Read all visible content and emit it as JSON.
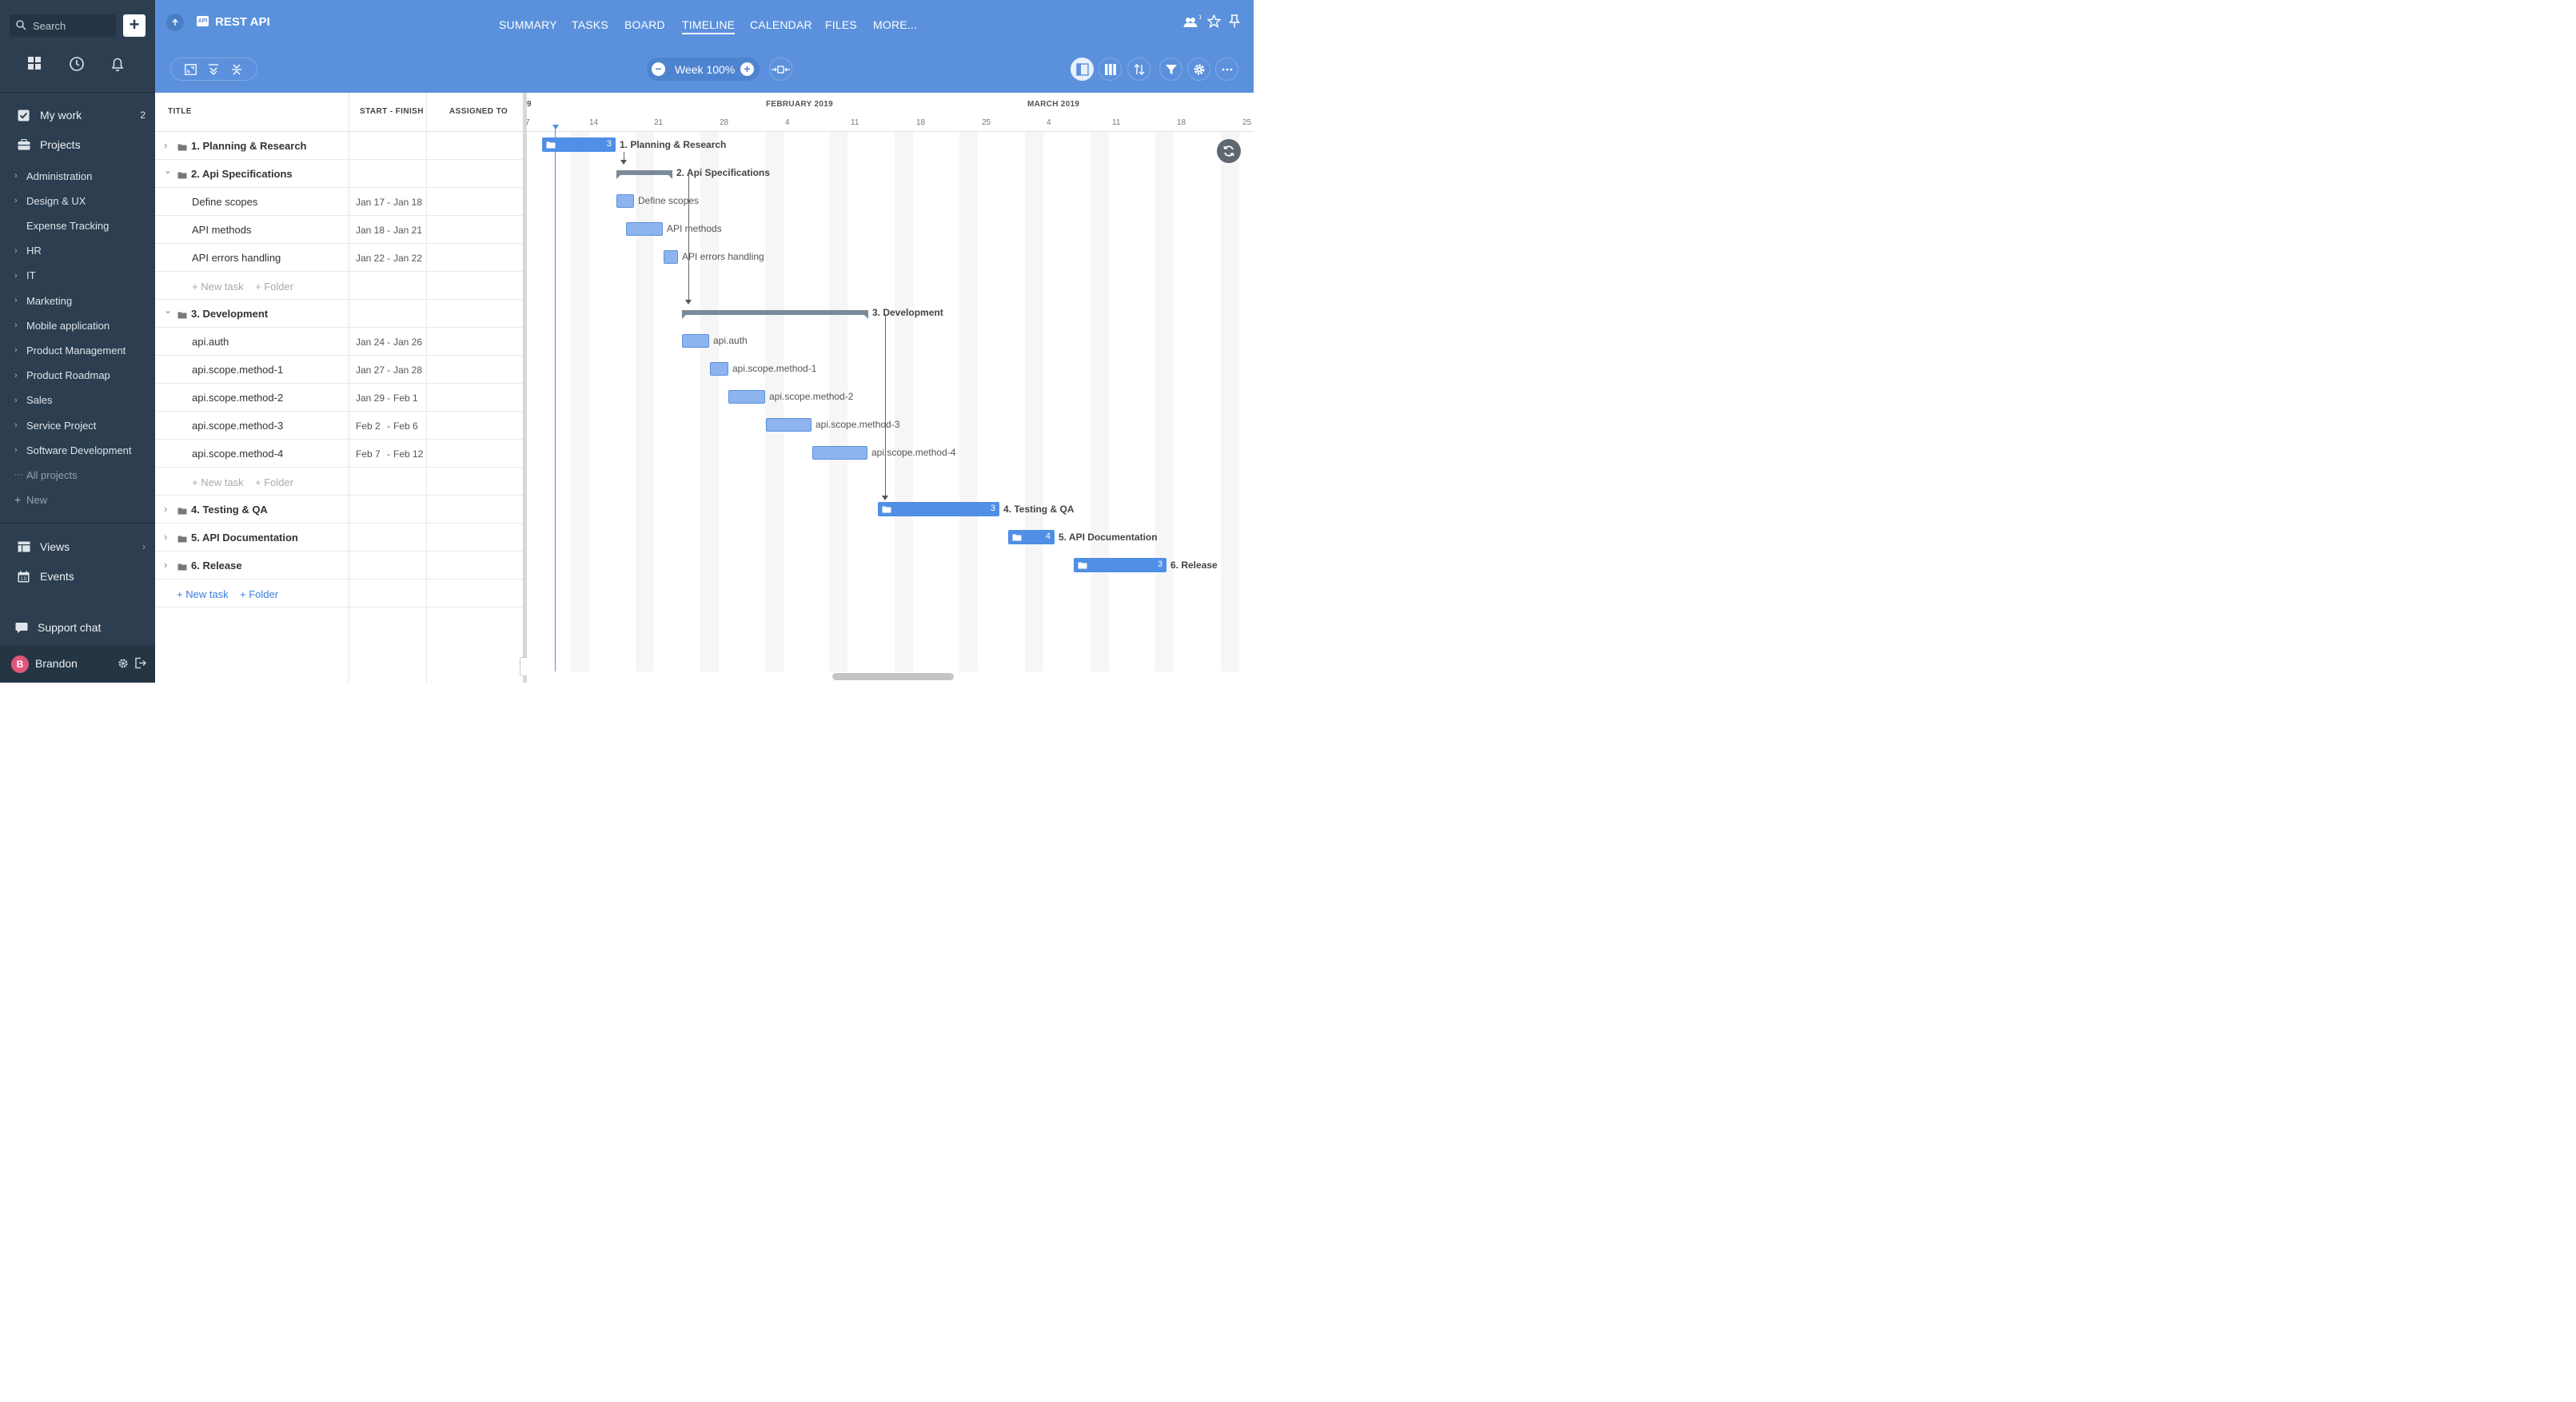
{
  "sidebar": {
    "search_label": "Search",
    "my_work": {
      "label": "My work",
      "count": "2"
    },
    "projects_label": "Projects",
    "projects": [
      {
        "label": "Administration",
        "chev": true
      },
      {
        "label": "Design & UX",
        "chev": true
      },
      {
        "label": "Expense Tracking",
        "chev": false
      },
      {
        "label": "HR",
        "chev": true
      },
      {
        "label": "IT",
        "chev": true
      },
      {
        "label": "Marketing",
        "chev": true
      },
      {
        "label": "Mobile application",
        "chev": true
      },
      {
        "label": "Product Management",
        "chev": true
      },
      {
        "label": "Product Roadmap",
        "chev": true
      },
      {
        "label": "Sales",
        "chev": true
      },
      {
        "label": "Service Project",
        "chev": true
      },
      {
        "label": "Software Development",
        "chev": true
      }
    ],
    "all_projects": "All projects",
    "new_label": "New",
    "views_label": "Views",
    "events_label": "Events",
    "support_chat": "Support chat",
    "user": {
      "initial": "B",
      "name": "Brandon"
    }
  },
  "header": {
    "badge": "API",
    "title": "REST API",
    "tabs": [
      "SUMMARY",
      "TASKS",
      "BOARD",
      "TIMELINE",
      "CALENDAR",
      "FILES",
      "MORE..."
    ],
    "active_tab": "TIMELINE",
    "members_count": "1",
    "zoom_label": "Week 100%"
  },
  "table": {
    "headers": {
      "title": "TITLE",
      "start_finish": "START - FINISH",
      "assigned_to": "ASSIGNED TO"
    },
    "rows": [
      {
        "type": "folder",
        "title": "1. Planning & Research",
        "expanded": false
      },
      {
        "type": "folder",
        "title": "2. Api Specifications",
        "expanded": true
      },
      {
        "type": "task",
        "title": "Define scopes",
        "start": "Jan 17",
        "end": "Jan 18"
      },
      {
        "type": "task",
        "title": "API methods",
        "start": "Jan 18",
        "end": "Jan 21"
      },
      {
        "type": "task",
        "title": "API errors handling",
        "start": "Jan 22",
        "end": "Jan 22"
      },
      {
        "type": "add",
        "new_task": "+ New task",
        "folder": "+ Folder"
      },
      {
        "type": "folder",
        "title": "3. Development",
        "expanded": true
      },
      {
        "type": "task",
        "title": "api.auth",
        "start": "Jan 24",
        "end": "Jan 26"
      },
      {
        "type": "task",
        "title": "api.scope.method-1",
        "start": "Jan 27",
        "end": "Jan 28"
      },
      {
        "type": "task",
        "title": "api.scope.method-2",
        "start": "Jan 29",
        "end": "Feb 1"
      },
      {
        "type": "task",
        "title": "api.scope.method-3",
        "start": "Feb 2",
        "end": "Feb 6"
      },
      {
        "type": "task",
        "title": "api.scope.method-4",
        "start": "Feb 7",
        "end": "Feb 12"
      },
      {
        "type": "add",
        "new_task": "+ New task",
        "folder": "+ Folder"
      },
      {
        "type": "folder",
        "title": "4. Testing & QA",
        "expanded": false
      },
      {
        "type": "folder",
        "title": "5. API Documentation",
        "expanded": false
      },
      {
        "type": "folder",
        "title": "6. Release",
        "expanded": false
      },
      {
        "type": "add_root",
        "new_task": "+ New task",
        "folder": "+ Folder"
      }
    ]
  },
  "timeline": {
    "months": [
      {
        "label": "FEBRUARY 2019"
      },
      {
        "label": "MARCH 2019"
      }
    ],
    "days": [
      "7",
      "14",
      "21",
      "28",
      "4",
      "11",
      "18",
      "25",
      "4",
      "11",
      "18",
      "25"
    ],
    "partial_day_label": "9",
    "bars": [
      {
        "kind": "folder",
        "label": "1. Planning & Research",
        "count": "3"
      },
      {
        "kind": "summary",
        "label": "2. Api Specifications"
      },
      {
        "kind": "task",
        "label": "Define scopes"
      },
      {
        "kind": "task",
        "label": "API methods"
      },
      {
        "kind": "task",
        "label": "API errors handling"
      },
      {
        "kind": "summary",
        "label": "3. Development"
      },
      {
        "kind": "task",
        "label": "api.auth"
      },
      {
        "kind": "task",
        "label": "api.scope.method-1"
      },
      {
        "kind": "task",
        "label": "api.scope.method-2"
      },
      {
        "kind": "task",
        "label": "api.scope.method-3"
      },
      {
        "kind": "task",
        "label": "api.scope.method-4"
      },
      {
        "kind": "folder",
        "label": "4. Testing & QA",
        "count": "3"
      },
      {
        "kind": "folder",
        "label": "5. API Documentation",
        "count": "4"
      },
      {
        "kind": "folder",
        "label": "6. Release",
        "count": "3"
      }
    ]
  },
  "colors": {
    "sidebar_bg": "#2c3e50",
    "header_bg": "#5b91dc",
    "folder_bar": "#4f8fe5",
    "task_bar": "#8db4ee",
    "summary_bar": "#7a8a98",
    "today_line": "#4a90e2"
  }
}
